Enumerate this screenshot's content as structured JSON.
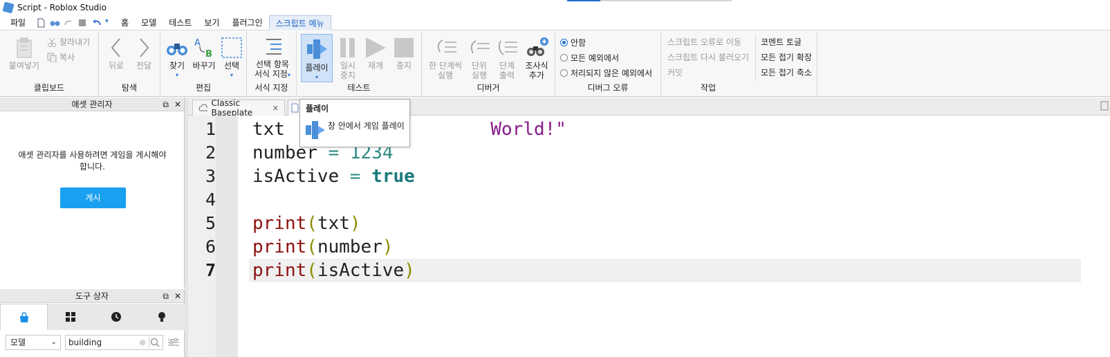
{
  "window": {
    "title": "Script - Roblox Studio"
  },
  "menu": {
    "file": "파일",
    "items": [
      "홈",
      "모델",
      "테스트",
      "보기",
      "플러그인",
      "스크립트 메뉴"
    ]
  },
  "ribbon": {
    "clipboard": {
      "label": "클립보드",
      "paste": "붙여넣기",
      "cut": "잘라내기",
      "copy": "복사"
    },
    "navigate": {
      "label": "탐색",
      "back": "뒤로",
      "forward": "전달"
    },
    "edit": {
      "label": "편집",
      "find": "찾기",
      "replace": "바꾸기",
      "select": "선택"
    },
    "format": {
      "label": "서식 지정",
      "format_selection_1": "선택 항목",
      "format_selection_2": "서식 지정"
    },
    "test": {
      "label": "테스트",
      "play": "플레이",
      "pause_1": "일시",
      "pause_2": "중지",
      "resume": "재개",
      "stop": "중지"
    },
    "debugger": {
      "label": "디버거",
      "step_over_1": "한 단계씩",
      "step_over_2": "실행",
      "step_into_1": "단위",
      "step_into_2": "실행",
      "step_out_1": "단계",
      "step_out_2": "출력",
      "watch_1": "조사식",
      "watch_2": "추가"
    },
    "debug_errors": {
      "label": "디버그 오류",
      "never": "안함",
      "all": "모든 예외에서",
      "unhandled": "처리되지 않은 예외에서"
    },
    "actions": {
      "label": "작업",
      "goto_error": "스크립트 오류로 이동",
      "reload": "스크립트 다시 불러오기",
      "commit": "커밋",
      "toggle_comment": "코멘트 토글",
      "expand_all": "모든 접기 확장",
      "collapse_all": "모든 접기 축소"
    }
  },
  "asset_manager": {
    "title": "애셋 관리자",
    "message_1": "애셋 관리자를 사용하려면 게임을 게시해야",
    "message_2": "합니다.",
    "publish": "게시"
  },
  "toolbox": {
    "title": "도구 상자",
    "category": "모델",
    "search_value": "building"
  },
  "tabs": {
    "baseplate": "Classic Baseplate"
  },
  "tooltip": {
    "title": "플레이",
    "body": "창 안에서 게임 플레이"
  },
  "editor": {
    "line_numbers": [
      "1",
      "2",
      "3",
      "4",
      "5",
      "6",
      "7"
    ],
    "line1_var": "txt",
    "line1_str": "World!\"",
    "line2_var": "number",
    "line2_op": "=",
    "line2_num": "1234",
    "line3_var": "isActive",
    "line3_op": "=",
    "line3_bool": "true",
    "print_fn": "print",
    "paren_open": "(",
    "paren_close": ")",
    "arg5": "txt",
    "arg6": "number",
    "arg7": "isActive"
  }
}
